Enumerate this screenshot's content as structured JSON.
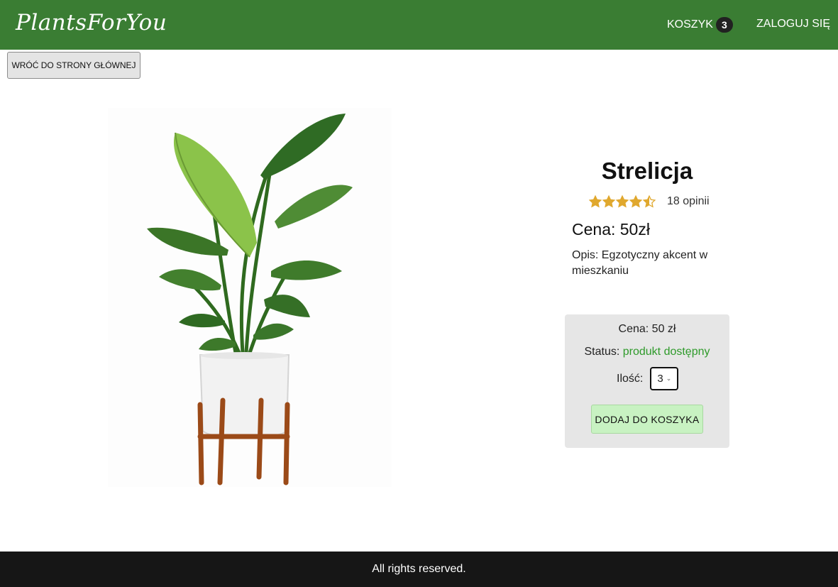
{
  "navbar": {
    "brand": "PlantsForYou",
    "cart_label": "KOSZYK",
    "cart_count": "3",
    "login_label": "ZALOGUJ SIĘ"
  },
  "back_button": {
    "label": "WRÓĆ DO STRONY GŁÓWNEJ"
  },
  "product": {
    "name": "Strelicja",
    "rating": 4.5,
    "reviews": "18 opinii",
    "price": "Cena: 50zł",
    "description": "Opis: Egzotyczny akcent w mieszkaniu"
  },
  "buy_box": {
    "price": "Cena: 50 zł",
    "status_label": "Status:",
    "status_value": "produkt dostępny",
    "qty_label": "Ilość:",
    "qty_value": "3",
    "add_button": "DODAJ DO KOSZYKA"
  },
  "footer": {
    "text": "All rights reserved."
  },
  "colors": {
    "navbar": "#3a7d33",
    "star": "#e0a82e",
    "status": "#2e9a2a",
    "add_button": "#c8f2c2",
    "footer": "#161616"
  }
}
